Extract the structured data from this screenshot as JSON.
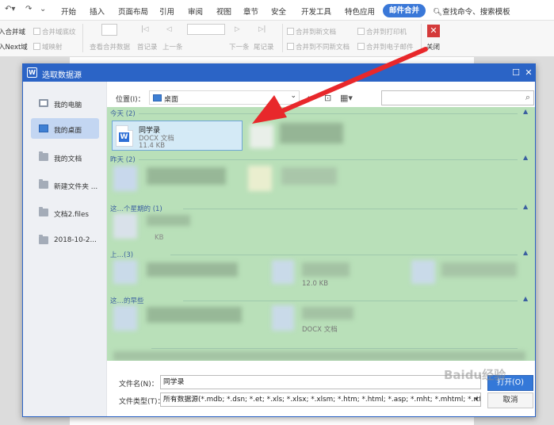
{
  "ribbon": {
    "tabs": [
      "开始",
      "插入",
      "页面布局",
      "引用",
      "审阅",
      "视图",
      "章节",
      "安全",
      "开发工具",
      "特色应用",
      "邮件合并"
    ],
    "active_tab": "邮件合并",
    "search_label": "查找命令、搜索模板",
    "tools": {
      "merge_fields": "入合并域",
      "merge_fields2": "合并域底纹",
      "next_field": "入Next域",
      "field_map": "域映射",
      "view_merged": "查看合并数据",
      "first_record": "首记录",
      "prev_record": "上一条",
      "next_record": "下一条",
      "last_record": "尾记录",
      "merge_new_doc": "合并到新文档",
      "merge_diff_doc": "合并到不同新文档",
      "merge_printer": "合并到打印机",
      "merge_email": "合并到电子邮件",
      "close": "关闭"
    }
  },
  "dialog": {
    "title": "选取数据源",
    "sidebar": [
      {
        "label": "我的电脑",
        "icon": "monitor-icon"
      },
      {
        "label": "我的桌面",
        "icon": "desktop-icon",
        "selected": true
      },
      {
        "label": "我的文档",
        "icon": "folder-icon"
      },
      {
        "label": "新建文件夹 ...",
        "icon": "folder-icon"
      },
      {
        "label": "文档2.files",
        "icon": "folder-icon"
      },
      {
        "label": "2018-10-2...",
        "icon": "folder-icon"
      }
    ],
    "location_label": "位置(I)：",
    "location_value": "桌面",
    "groups": [
      {
        "header": "今天 (2)"
      },
      {
        "header": "昨天 (2)"
      },
      {
        "header": "这…个星期的 (1)"
      },
      {
        "header": "上…(3)"
      },
      {
        "header": "这…的早些"
      }
    ],
    "selected_file": {
      "name": "同学录",
      "type": "DOCX 文档",
      "size": "11.4 KB"
    },
    "blurred_sizes": [
      "KB",
      "12.0 KB",
      "DOCX 文档"
    ],
    "filename_label": "文件名(N)：",
    "filename_value": "同学录",
    "filetype_label": "文件类型(T)：",
    "filetype_value": "所有数据源(*.mdb; *.dsn; *.et; *.xls; *.xlsx; *.xlsm; *.htm; *.html; *.asp; *.mht; *.mhtml; *.rtf; *.docx; *.doc",
    "open_label": "打开(O)",
    "cancel_label": "取消"
  },
  "watermark": "Baidu经验"
}
